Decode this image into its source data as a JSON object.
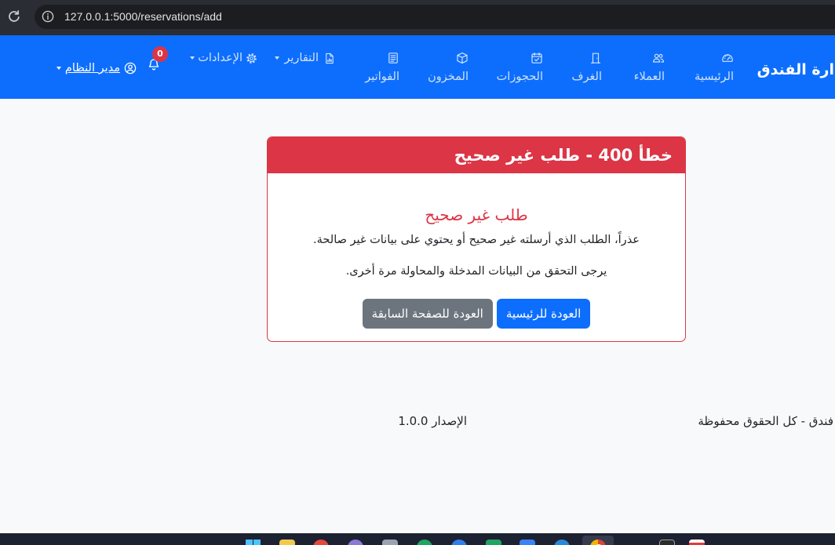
{
  "browser": {
    "url": "127.0.0.1:5000/reservations/add",
    "reload_icon": "reload-icon",
    "site_info_icon": "info-icon"
  },
  "navbar": {
    "brand": "ارة الفندق",
    "items": [
      {
        "label": "الرئيسية",
        "icon": "speedometer-icon"
      },
      {
        "label": "العملاء",
        "icon": "people-icon"
      },
      {
        "label": "الغرف",
        "icon": "door-icon"
      },
      {
        "label": "الحجوزات",
        "icon": "calendar-check-icon"
      },
      {
        "label": "المخزون",
        "icon": "box-icon"
      },
      {
        "label": "الفواتير",
        "icon": "receipt-icon"
      }
    ],
    "dropdowns": [
      {
        "label": "التقارير",
        "icon": "bar-chart-file-icon"
      },
      {
        "label": "الإعدادات",
        "icon": "gear-icon"
      }
    ],
    "notifications": {
      "icon": "bell-icon",
      "count": "0"
    },
    "user": {
      "label": "مدير النظام",
      "icon": "person-circle-icon"
    }
  },
  "error_card": {
    "title": "خطأ 400 - طلب غير صحيح",
    "heading": "طلب غير صحيح",
    "message": "عذراً، الطلب الذي أرسلته غير صحيح أو يحتوي على بيانات غير صالحة.",
    "hint": "يرجى التحقق من البيانات المدخلة والمحاولة مرة أخرى.",
    "buttons": {
      "home": "العودة للرئيسية",
      "back": "العودة للصفحة السابقة"
    }
  },
  "footer": {
    "copyright": "فندق - كل الحقوق محفوظة",
    "version": "الإصدار 1.0.0"
  },
  "taskbar": {
    "apps": [
      "windows-start-icon",
      "file-explorer-icon",
      "red-app-icon",
      "purple-app-icon",
      "gray-app-icon",
      "green-app-icon",
      "blue-app-icon",
      "spreadsheet-app-icon",
      "blue-arrow-app-icon",
      "edge-browser-icon",
      "chrome-browser-icon",
      "terminal-icon",
      "calendar-app-icon"
    ]
  },
  "colors": {
    "primary": "#0d6efd",
    "danger": "#dc3545",
    "secondary": "#6c757d",
    "background": "#f8f9fa"
  }
}
